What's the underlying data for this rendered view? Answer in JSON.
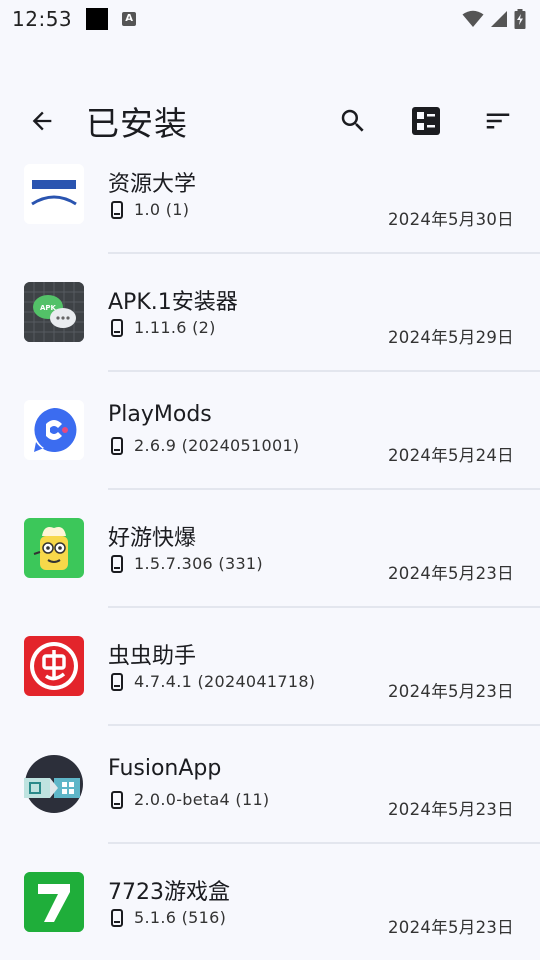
{
  "status_bar": {
    "time": "12:53",
    "notifications": [
      "black-square-icon",
      "text-a-icon"
    ],
    "indicators": [
      "wifi-icon",
      "signal-icon",
      "battery-charging-icon"
    ]
  },
  "app_bar": {
    "title": "已安装",
    "actions": [
      "search-icon",
      "view-toggle-icon",
      "sort-icon"
    ]
  },
  "apps": [
    {
      "name": "资源大学",
      "version": "1.0 (1)",
      "date": "2024年5月30日",
      "icon": "resource-app-icon"
    },
    {
      "name": "APK.1安装器",
      "version": "1.11.6 (2)",
      "date": "2024年5月29日",
      "icon": "apk-installer-icon"
    },
    {
      "name": "PlayMods",
      "version": "2.6.9 (2024051001)",
      "date": "2024年5月24日",
      "icon": "playmods-icon"
    },
    {
      "name": "好游快爆",
      "version": "1.5.7.306 (331)",
      "date": "2024年5月23日",
      "icon": "haoyou-icon"
    },
    {
      "name": "虫虫助手",
      "version": "4.7.4.1 (2024041718)",
      "date": "2024年5月23日",
      "icon": "chongchong-icon"
    },
    {
      "name": "FusionApp",
      "version": "2.0.0-beta4 (11)",
      "date": "2024年5月23日",
      "icon": "fusionapp-icon"
    },
    {
      "name": "7723游戏盒",
      "version": "5.1.6 (516)",
      "date": "2024年5月23日",
      "icon": "7723-icon"
    }
  ],
  "colors": {
    "background": "#f7f8fd",
    "divider": "#e3e6ee",
    "apk_green": "#53c168",
    "playmods_blue": "#3b6cf0",
    "haoyou_green": "#3cc75a",
    "chongchong_red": "#e3242b",
    "fusion_dark": "#2c2f3a",
    "game7723_green": "#1fae3a"
  }
}
